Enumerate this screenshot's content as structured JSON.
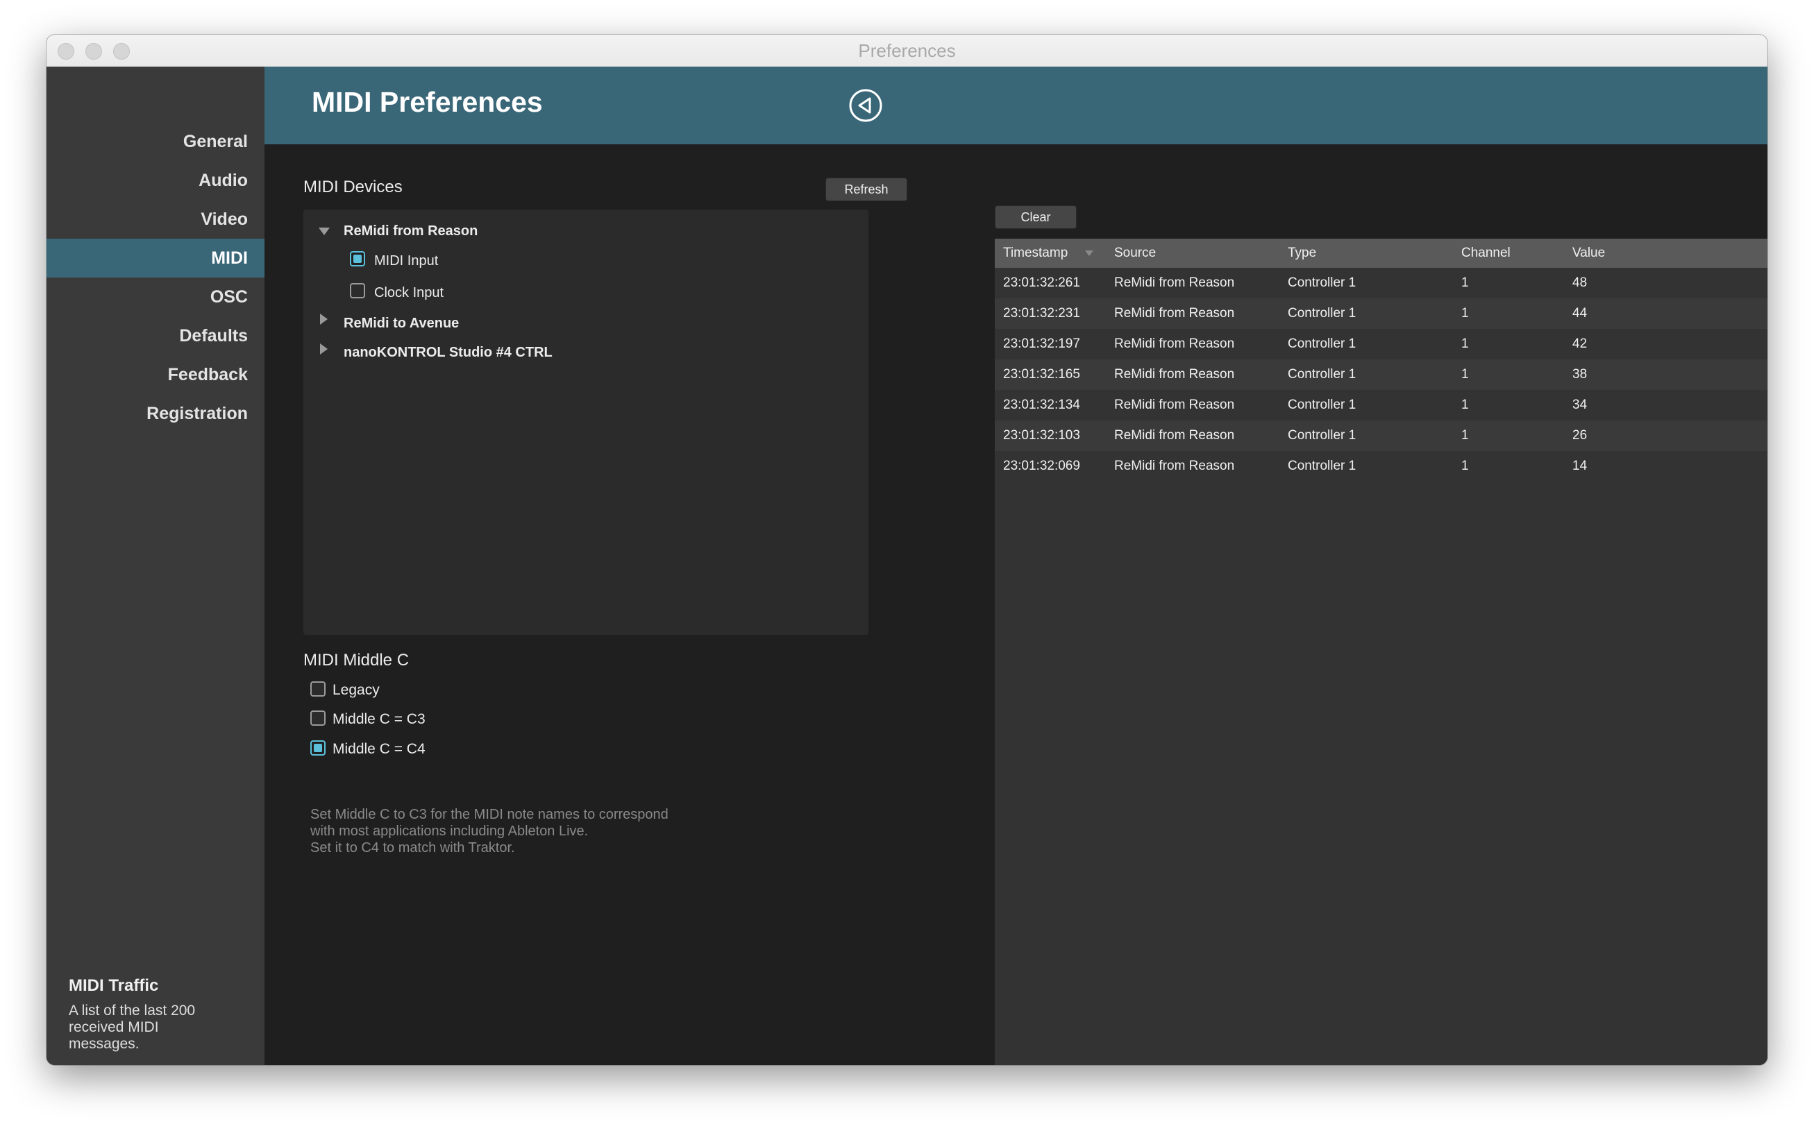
{
  "window": {
    "title": "Preferences"
  },
  "sidebar": {
    "items": [
      {
        "label": "General"
      },
      {
        "label": "Audio"
      },
      {
        "label": "Video"
      },
      {
        "label": "MIDI",
        "active": true
      },
      {
        "label": "OSC"
      },
      {
        "label": "Defaults"
      },
      {
        "label": "Feedback"
      },
      {
        "label": "Registration"
      }
    ],
    "help_title": "MIDI Traffic",
    "help_text": "A list of the last 200 received MIDI messages."
  },
  "header": {
    "title": "MIDI Preferences",
    "back_icon": "back-circle-icon"
  },
  "devices": {
    "label": "MIDI Devices",
    "refresh_label": "Refresh",
    "tree": [
      {
        "name": "ReMidi from Reason",
        "expanded": true,
        "options": [
          {
            "label": "MIDI Input",
            "checked": true
          },
          {
            "label": "Clock Input",
            "checked": false
          }
        ]
      },
      {
        "name": "ReMidi to Avenue",
        "expanded": false
      },
      {
        "name": "nanoKONTROL Studio #4 CTRL",
        "expanded": false
      }
    ]
  },
  "middle_c": {
    "label": "MIDI Middle C",
    "options": [
      {
        "label": "Legacy",
        "checked": false
      },
      {
        "label": "Middle C = C3",
        "checked": false
      },
      {
        "label": "Middle C = C4",
        "checked": true
      }
    ],
    "hint_lines": [
      "Set Middle C to C3 for the MIDI note names to correspond",
      "with most applications including Ableton Live.",
      "Set it to C4 to match with Traktor."
    ]
  },
  "traffic": {
    "clear_label": "Clear",
    "columns": [
      "Timestamp",
      "Source",
      "Type",
      "Channel",
      "Value"
    ],
    "rows": [
      [
        "23:01:32:261",
        "ReMidi from Reason",
        "Controller 1",
        "1",
        "48"
      ],
      [
        "23:01:32:231",
        "ReMidi from Reason",
        "Controller 1",
        "1",
        "44"
      ],
      [
        "23:01:32:197",
        "ReMidi from Reason",
        "Controller 1",
        "1",
        "42"
      ],
      [
        "23:01:32:165",
        "ReMidi from Reason",
        "Controller 1",
        "1",
        "38"
      ],
      [
        "23:01:32:134",
        "ReMidi from Reason",
        "Controller 1",
        "1",
        "34"
      ],
      [
        "23:01:32:103",
        "ReMidi from Reason",
        "Controller 1",
        "1",
        "26"
      ],
      [
        "23:01:32:069",
        "ReMidi from Reason",
        "Controller 1",
        "1",
        "14"
      ]
    ]
  },
  "colors": {
    "accent": "#3a6778",
    "checkbox": "#5cc0dc",
    "sidebar": "#3a3a3a",
    "content": "#1f1f1f"
  }
}
